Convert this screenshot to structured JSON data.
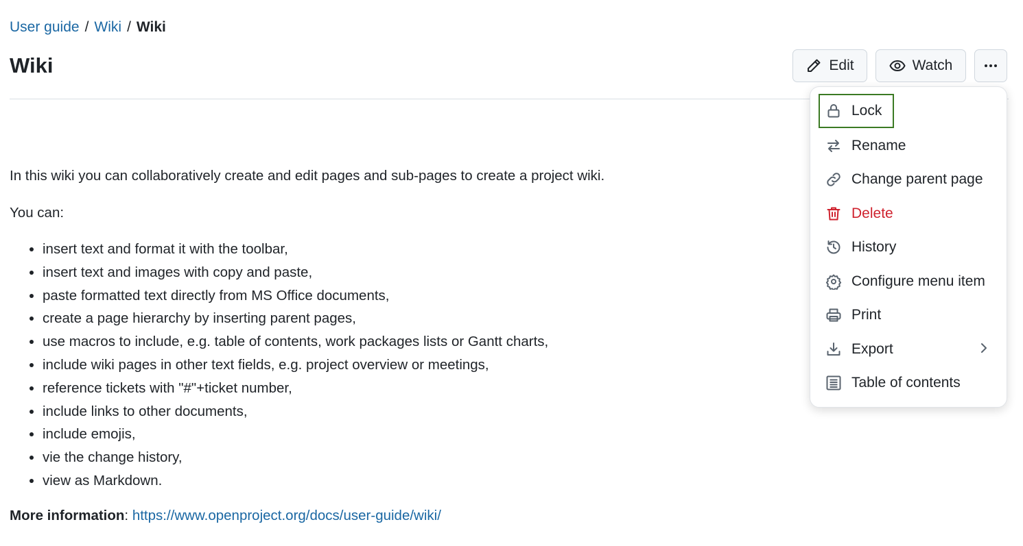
{
  "breadcrumb": {
    "items": [
      "User guide",
      "Wiki"
    ],
    "separator": "/",
    "current": "Wiki"
  },
  "header": {
    "title": "Wiki",
    "edit_label": "Edit",
    "watch_label": "Watch"
  },
  "content": {
    "intro": "In this wiki you can collaboratively create and edit pages and sub-pages to create a project wiki.",
    "you_can": "You can:",
    "features": [
      "insert text and format it with the toolbar,",
      "insert text and images with copy and paste,",
      "paste formatted text directly from MS Office documents,",
      "create a page hierarchy by inserting parent pages,",
      "use macros to include, e.g. table of contents, work packages lists or Gantt charts,",
      "include wiki pages in other text fields, e.g. project overview or meetings,",
      "reference tickets with \"#\"+ticket number,",
      "include links to other documents,",
      "include emojis,",
      "vie the change history,",
      "view as Markdown."
    ],
    "more_info_label": "More information",
    "more_info_link": "https://www.openproject.org/docs/user-guide/wiki/"
  },
  "menu": {
    "items": [
      {
        "label": "Lock",
        "icon": "lock-icon"
      },
      {
        "label": "Rename",
        "icon": "arrows-swap-icon"
      },
      {
        "label": "Change parent page",
        "icon": "link-icon"
      },
      {
        "label": "Delete",
        "icon": "trash-icon"
      },
      {
        "label": "History",
        "icon": "history-icon"
      },
      {
        "label": "Configure menu item",
        "icon": "gear-icon"
      },
      {
        "label": "Print",
        "icon": "printer-icon"
      },
      {
        "label": "Export",
        "icon": "download-icon"
      },
      {
        "label": "Table of contents",
        "icon": "list-icon"
      }
    ]
  },
  "colors": {
    "link": "#1a67a3",
    "danger": "#cf222e",
    "focus": "#3b7a23"
  }
}
